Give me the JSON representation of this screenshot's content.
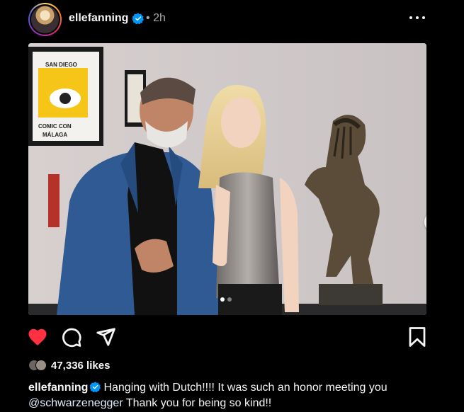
{
  "post": {
    "username": "elleFanning",
    "time": "2h",
    "separator": "•"
  },
  "photo": {
    "poster": {
      "line1": "SAN DIEGO",
      "brand": "COMIC CON",
      "city": "MÁLAGA"
    }
  },
  "carousel": {
    "total": 2,
    "active": 1
  },
  "likes": {
    "count": "47,336 likes"
  },
  "caption": {
    "username": "ellefanning",
    "text1": "Hanging with Dutch!!!! It was such an honor meeting you",
    "mention": "@schwarzenegger",
    "text2": "Thank you for being so kind!!"
  },
  "colors": {
    "like_red": "#ff3040",
    "verified_blue": "#0095f6",
    "mention_blue": "#e0efff"
  },
  "icons": [
    "heart-icon",
    "comment-icon",
    "share-icon",
    "bookmark-icon",
    "more-icon",
    "chevron-right-icon",
    "verified-icon"
  ]
}
